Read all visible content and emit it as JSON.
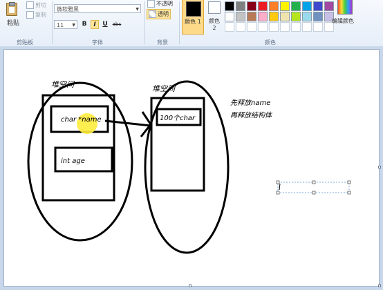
{
  "ribbon": {
    "clipboard": {
      "paste_label": "粘贴",
      "cut_label": "剪切",
      "copy_label": "复制",
      "group_label": "剪贴板"
    },
    "font": {
      "font_name": "微软雅黑",
      "font_size": "11",
      "bold": "B",
      "italic": "I",
      "underline": "U",
      "strike": "abc",
      "group_label": "字体"
    },
    "background": {
      "opaque_label": "不透明",
      "transparent_label": "透明",
      "group_label": "背景"
    },
    "colors": {
      "color1_label": "颜色 1",
      "color2_label": "颜色 2",
      "edit_label": "编辑颜色",
      "group_label": "颜色",
      "color1": "#000000",
      "color2": "#ffffff",
      "palette_row1": [
        "#000000",
        "#7f7f7f",
        "#880015",
        "#ed1c24",
        "#ff7f27",
        "#fff200",
        "#22b14c",
        "#00a2e8",
        "#3f48cc",
        "#a349a4"
      ],
      "palette_row2": [
        "#ffffff",
        "#c3c3c3",
        "#b97a57",
        "#ffaec9",
        "#ffc90e",
        "#efe4b0",
        "#b5e61d",
        "#99d9ea",
        "#7092be",
        "#c8bfe7"
      ]
    }
  },
  "canvas": {
    "heap1_label": "堆空间",
    "char_name_label": "char *name",
    "int_age_label": "int age",
    "heap2_label": "堆空间",
    "char100_label": "100个char",
    "note_line1": "先释放name",
    "note_line2": "再释放结构体"
  }
}
